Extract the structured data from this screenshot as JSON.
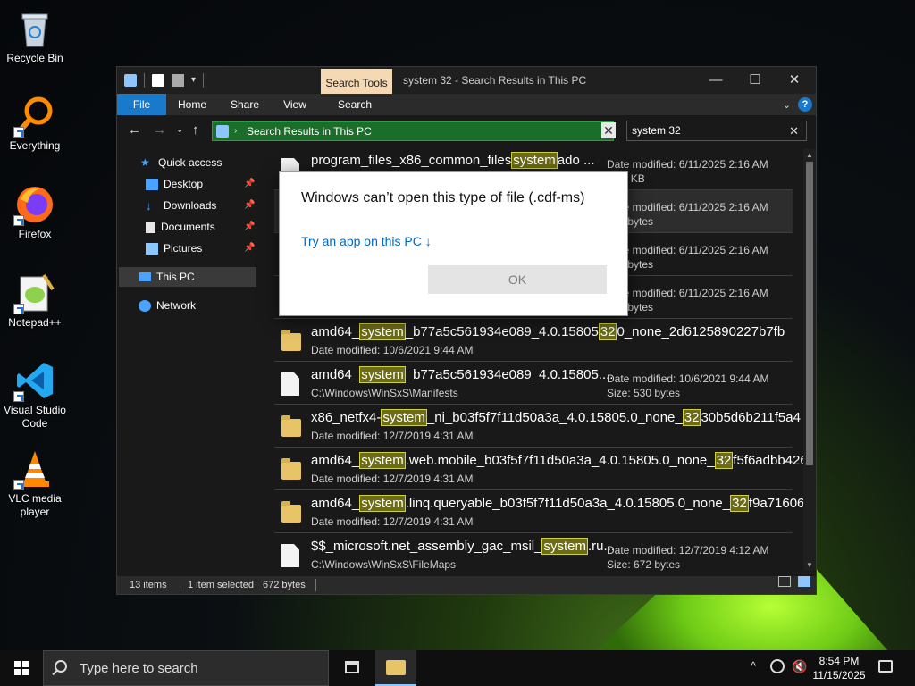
{
  "desktop": {
    "icons": [
      {
        "label": "Recycle Bin"
      },
      {
        "label": "Everything"
      },
      {
        "label": "Firefox"
      },
      {
        "label": "Notepad++"
      },
      {
        "label": "Visual Studio Code"
      },
      {
        "label": "VLC media player"
      }
    ]
  },
  "explorer": {
    "context_tab": "Search Tools",
    "title": "system 32 - Search Results in This PC",
    "ribbon_tabs": [
      "File",
      "Home",
      "Share",
      "View",
      "Search"
    ],
    "address": "Search Results in This PC",
    "search_query": "system 32",
    "nav": {
      "quick_access": "Quick access",
      "desktop": "Desktop",
      "downloads": "Downloads",
      "documents": "Documents",
      "pictures": "Pictures",
      "this_pc": "This PC",
      "network": "Network"
    },
    "rows": [
      {
        "name_parts": [
          "program_files_x86_common_files",
          "system",
          "ado ..."
        ],
        "date": "Date modified: 6/11/2025 2:16 AM",
        "size": "5.16 KB"
      },
      {
        "name_parts": [
          ""
        ],
        "date": "Date modified: 6/11/2025 2:16 AM",
        "size": "672 bytes"
      },
      {
        "name_parts": [
          ""
        ],
        "date": "Date modified: 6/11/2025 2:16 AM",
        "size": "932 bytes"
      },
      {
        "name_parts": [
          ""
        ],
        "date": "Date modified: 6/11/2025 2:16 AM",
        "size": "640 bytes"
      },
      {
        "name_parts": [
          "amd64_",
          "system",
          "_b77a5c561934e089_4.0.15805",
          "32",
          "0_none_2d6125890227b7fb"
        ],
        "sub": "Date modified: 10/6/2021 9:44 AM"
      },
      {
        "name_parts": [
          "amd64_",
          "system",
          "_b77a5c561934e089_4.0.15805...."
        ],
        "sub": "C:\\Windows\\WinSxS\\Manifests",
        "date": "Date modified: 10/6/2021 9:44 AM",
        "size": "Size: 530 bytes"
      },
      {
        "name_parts": [
          "x86_netfx4-",
          "system",
          "_ni_b03f5f7f11d50a3a_4.0.15805.0_none_",
          "32",
          "30b5d6b211f5a4"
        ],
        "sub": "Date modified: 12/7/2019 4:31 AM"
      },
      {
        "name_parts": [
          "amd64_",
          "system",
          ".web.mobile_b03f5f7f11d50a3a_4.0.15805.0_none_",
          "32",
          "f5f6adbb426..."
        ],
        "sub": "Date modified: 12/7/2019 4:31 AM"
      },
      {
        "name_parts": [
          "amd64_",
          "system",
          ".linq.queryable_b03f5f7f11d50a3a_4.0.15805.0_none_",
          "32",
          "f9a716066..."
        ],
        "sub": "Date modified: 12/7/2019 4:31 AM"
      },
      {
        "name_parts": [
          "$$_microsoft.net_assembly_gac_msil_",
          "system",
          ".ru..."
        ],
        "sub": "C:\\Windows\\WinSxS\\FileMaps",
        "date": "Date modified: 12/7/2019 4:12 AM",
        "size": "Size: 672 bytes"
      }
    ],
    "status": {
      "items": "13 items",
      "selected": "1 item selected",
      "selected_size": "672 bytes"
    }
  },
  "dialog": {
    "message": "Windows can’t open this type of file (.cdf-ms)",
    "link": "Try an app on this PC ↓",
    "ok_label": "OK"
  },
  "taskbar": {
    "search_placeholder": "Type here to search",
    "time": "8:54 PM",
    "date": "11/15/2025"
  }
}
